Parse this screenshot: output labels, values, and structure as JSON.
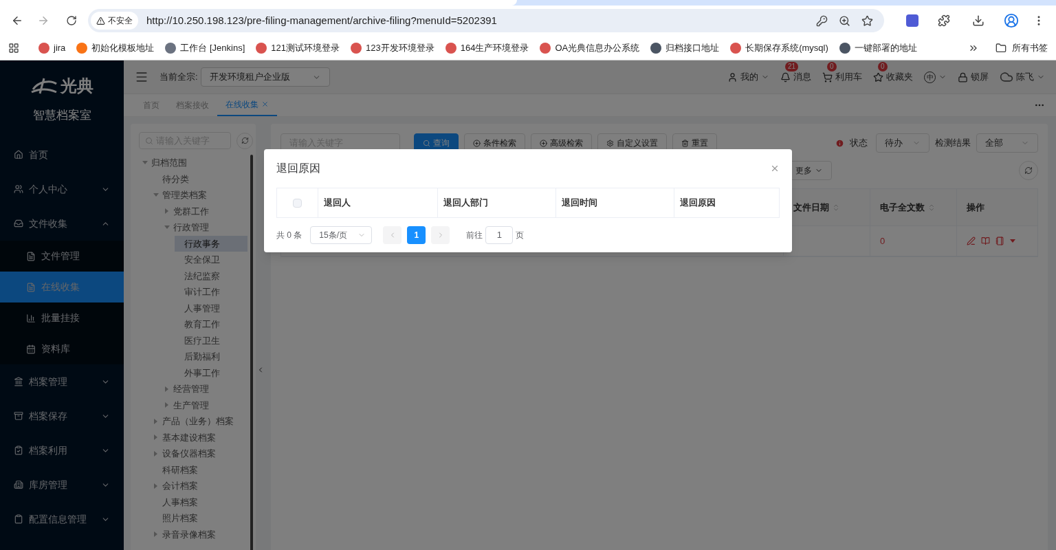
{
  "browser": {
    "security": "不安全",
    "address": "http://10.250.198.123/pre-filing-management/archive-filing?menuId=5202391",
    "bookmarks": [
      {
        "label": "jira"
      },
      {
        "label": "初始化模板地址"
      },
      {
        "label": "工作台 [Jenkins]"
      },
      {
        "label": "121测试环境登录"
      },
      {
        "label": "123开发环境登录"
      },
      {
        "label": "164生产环境登录"
      },
      {
        "label": "OA光典信息办公系统"
      },
      {
        "label": "归档接口地址"
      },
      {
        "label": "长期保存系统(mysql)"
      },
      {
        "label": "一键部署的地址"
      }
    ],
    "all_bookmarks": "所有书签"
  },
  "logo": {
    "name": "光典",
    "subtitle": "智慧档案室"
  },
  "menu": [
    {
      "label": "首页",
      "selected": false
    },
    {
      "label": "个人中心",
      "expanded": false,
      "selected": false
    },
    {
      "label": "文件收集",
      "expanded": true,
      "selected": false,
      "children": [
        {
          "label": "文件管理",
          "selected": false
        },
        {
          "label": "在线收集",
          "selected": true
        },
        {
          "label": "批量挂接",
          "selected": false
        },
        {
          "label": "资料库",
          "selected": false
        }
      ]
    },
    {
      "label": "档案管理",
      "expanded": false,
      "selected": false
    },
    {
      "label": "档案保存",
      "expanded": false,
      "selected": false
    },
    {
      "label": "档案利用",
      "expanded": false,
      "selected": false
    },
    {
      "label": "库房管理",
      "expanded": false,
      "selected": false
    },
    {
      "label": "配置信息管理",
      "expanded": false,
      "selected": false
    }
  ],
  "header": {
    "fonds_label": "当前全宗:",
    "fonds_value": "开发环境租户企业版",
    "items": [
      {
        "kind": "user",
        "label": "我的"
      },
      {
        "kind": "bell",
        "label": "消息",
        "badge": "21"
      },
      {
        "kind": "cart",
        "label": "利用车",
        "badge": "0"
      },
      {
        "kind": "star",
        "label": "收藏夹",
        "badge": "0"
      },
      {
        "kind": "lang",
        "label": "中"
      },
      {
        "kind": "lock",
        "label": "锁屏"
      },
      {
        "kind": "avatar",
        "label": "陈飞"
      }
    ]
  },
  "tabs": [
    {
      "label": "首页",
      "selected": false
    },
    {
      "label": "档案接收",
      "selected": false
    },
    {
      "label": "在线收集",
      "selected": true
    }
  ],
  "tree": {
    "placeholder": "请输入关键字",
    "nodes": [
      {
        "label": "归档范围",
        "expanded": true,
        "selected": false,
        "children": [
          {
            "label": "待分类",
            "selected": false
          },
          {
            "label": "管理类档案",
            "expanded": true,
            "selected": false,
            "children": [
              {
                "label": "党群工作",
                "expanded": false,
                "selected": false
              },
              {
                "label": "行政管理",
                "expanded": true,
                "selected": false,
                "children": [
                  {
                    "label": "行政事务",
                    "selected": true
                  },
                  {
                    "label": "安全保卫",
                    "selected": false
                  },
                  {
                    "label": "法纪监察",
                    "selected": false
                  },
                  {
                    "label": "审计工作",
                    "selected": false
                  },
                  {
                    "label": "人事管理",
                    "selected": false
                  },
                  {
                    "label": "教育工作",
                    "selected": false
                  },
                  {
                    "label": "医疗卫生",
                    "selected": false
                  },
                  {
                    "label": "后勤福利",
                    "selected": false
                  },
                  {
                    "label": "外事工作",
                    "selected": false
                  }
                ]
              },
              {
                "label": "经营管理",
                "expanded": false,
                "selected": false
              },
              {
                "label": "生产管理",
                "expanded": false,
                "selected": false
              }
            ]
          },
          {
            "label": "产品（业务）档案",
            "expanded": false,
            "selected": false
          },
          {
            "label": "基本建设档案",
            "expanded": false,
            "selected": false
          },
          {
            "label": "设备仪器档案",
            "expanded": false,
            "selected": false
          },
          {
            "label": "科研档案",
            "selected": false
          },
          {
            "label": "会计档案",
            "expanded": false,
            "selected": false
          },
          {
            "label": "人事档案",
            "selected": false
          },
          {
            "label": "照片档案",
            "selected": false
          },
          {
            "label": "录音录像档案",
            "expanded": false,
            "selected": false
          }
        ]
      }
    ]
  },
  "toolbar": {
    "placeholder": "请输入关键字",
    "buttons": [
      {
        "kind": "primary",
        "label": "查询"
      },
      {
        "kind": "filter",
        "label": "条件检索"
      },
      {
        "kind": "filter",
        "label": "高级检索"
      },
      {
        "kind": "settings",
        "label": "自定义设置"
      },
      {
        "kind": "reset",
        "label": "重置"
      }
    ],
    "status_label": "状态",
    "status_value": "待办",
    "result_label": "检测结果",
    "result_value": "全部",
    "more": "更多"
  },
  "table": {
    "columns": [
      "文件日期",
      "电子全文数",
      "操作"
    ],
    "rows": [
      {
        "file_count": "0"
      }
    ]
  },
  "dialog": {
    "title": "退回原因",
    "select_all_checked": false,
    "columns": [
      "退回人",
      "退回人部门",
      "退回时间",
      "退回原因"
    ],
    "total": "共 0 条",
    "page_size": "15条/页",
    "pages": [
      {
        "label": "1",
        "selected": true
      }
    ],
    "goto_label": "前往",
    "goto_value": "1",
    "goto_unit": "页"
  }
}
